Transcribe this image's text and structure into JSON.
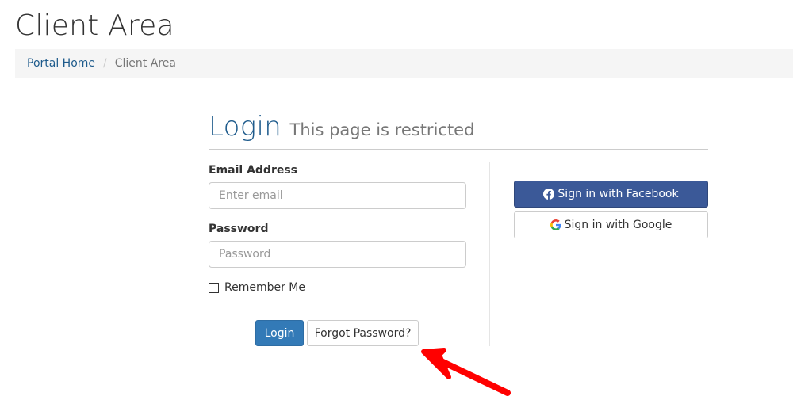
{
  "page": {
    "title": "Client Area"
  },
  "breadcrumb": {
    "home": "Portal Home",
    "separator": "/",
    "current": "Client Area"
  },
  "login": {
    "heading": "Login",
    "subheading": "This page is restricted",
    "email_label": "Email Address",
    "email_placeholder": "Enter email",
    "email_value": "",
    "password_label": "Password",
    "password_placeholder": "Password",
    "password_value": "",
    "remember_label": "Remember Me",
    "remember_checked": false,
    "login_button": "Login",
    "forgot_button": "Forgot Password?"
  },
  "social": {
    "facebook_label": "Sign in with Facebook",
    "google_label": "Sign in with Google",
    "facebook_icon": "facebook-icon",
    "google_icon": "google-icon"
  },
  "annotation": {
    "icon": "red-arrow-icon",
    "color": "#ff0000"
  },
  "colors": {
    "primary": "#337ab7",
    "facebook": "#3b5998",
    "link": "#1e5b8c"
  }
}
